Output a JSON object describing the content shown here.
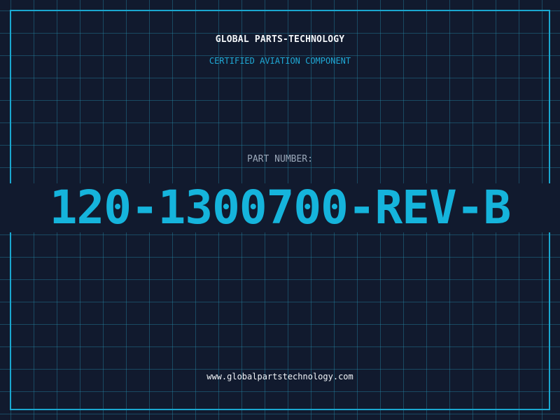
{
  "header": {
    "brand": "GLOBAL PARTS-TECHNOLOGY",
    "subtitle": "CERTIFIED AVIATION COMPONENT"
  },
  "part": {
    "label": "PART NUMBER:",
    "number": "120-1300700-REV-B"
  },
  "footer": {
    "url": "www.globalpartstechnology.com"
  },
  "colors": {
    "background": "#111a2e",
    "grid": "#2896b4",
    "frame": "#1aa7d0",
    "accent": "#15b4dc",
    "text": "#f2f5f8",
    "muted": "#9aa7b8"
  }
}
